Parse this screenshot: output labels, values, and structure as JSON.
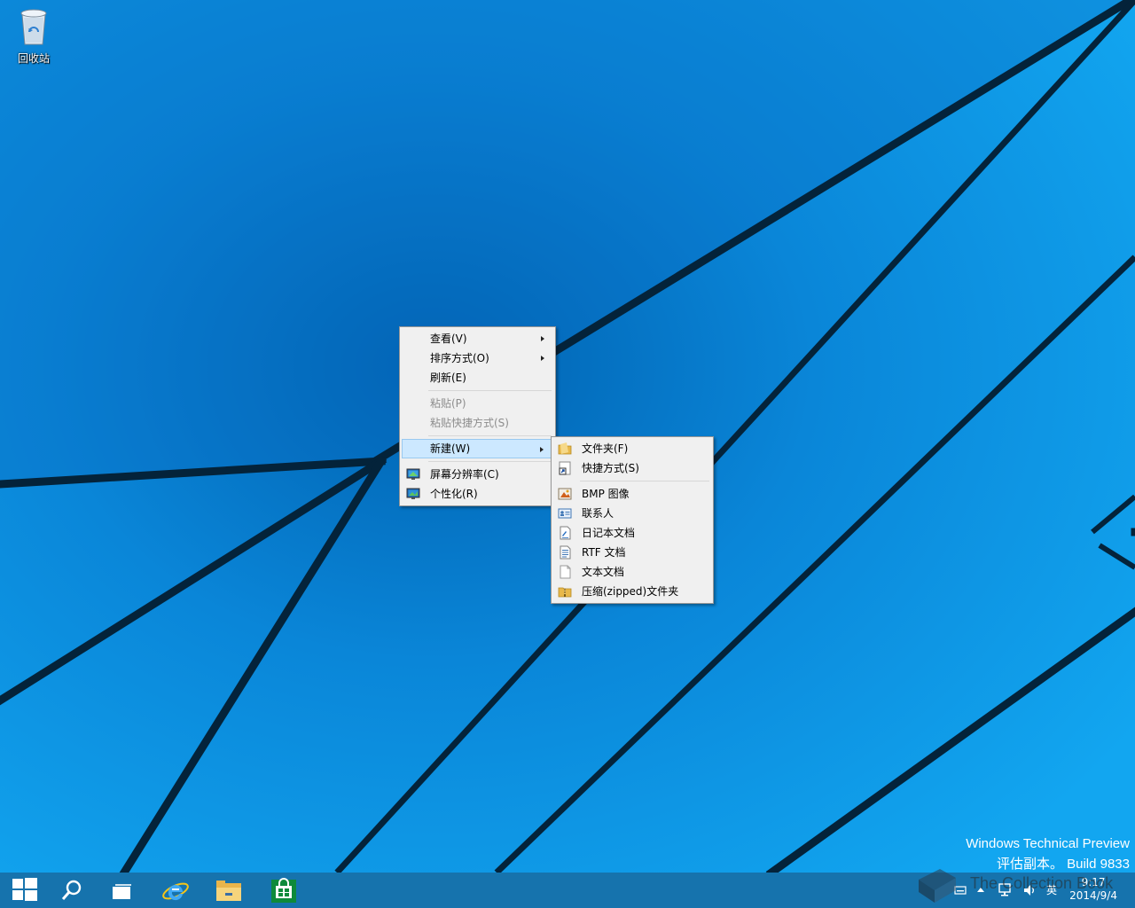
{
  "desktop": {
    "recycle_bin_label": "回收站"
  },
  "context_menu": {
    "items": [
      {
        "label": "查看(V)"
      },
      {
        "label": "排序方式(O)"
      },
      {
        "label": "刷新(E)"
      },
      {
        "label": "粘贴(P)"
      },
      {
        "label": "粘贴快捷方式(S)"
      },
      {
        "label": "新建(W)"
      },
      {
        "label": "屏幕分辨率(C)"
      },
      {
        "label": "个性化(R)"
      }
    ]
  },
  "new_submenu": {
    "items": [
      {
        "label": "文件夹(F)"
      },
      {
        "label": "快捷方式(S)"
      },
      {
        "label": "BMP 图像"
      },
      {
        "label": "联系人"
      },
      {
        "label": "日记本文档"
      },
      {
        "label": "RTF 文档"
      },
      {
        "label": "文本文档"
      },
      {
        "label": "压缩(zipped)文件夹"
      }
    ]
  },
  "watermark": {
    "line1": "Windows Technical Preview",
    "line2": "评估副本。 Build 9833"
  },
  "overlay": {
    "collection_text": "The Collection Book"
  },
  "taskbar": {
    "tray_ime": "英",
    "time": "9:17",
    "date": "2014/9/4"
  },
  "colors": {
    "wallpaper_blue": "#0a8fe0",
    "taskbar": "#1673ad",
    "menu_bg": "#f0f0f0",
    "menu_highlight": "#cce8ff",
    "store_green": "#0e8a3a"
  }
}
